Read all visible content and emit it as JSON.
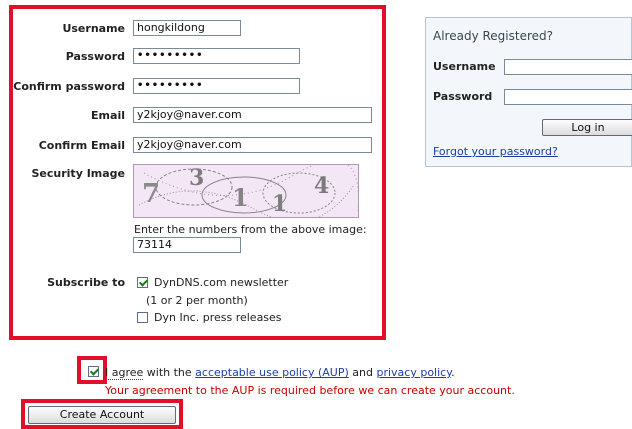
{
  "registration": {
    "username_label": "Username",
    "username_value": "hongkildong",
    "password_label": "Password",
    "password_value": "•••••••••",
    "confirm_password_label": "Confirm password",
    "confirm_password_value": "•••••••••",
    "email_label": "Email",
    "email_value": "y2kjoy@naver.com",
    "confirm_email_label": "Confirm Email",
    "confirm_email_value": "y2kjoy@naver.com",
    "security_image_label": "Security Image",
    "captcha_digits": [
      "7",
      "3",
      "1",
      "1",
      "4"
    ],
    "captcha_prompt": "Enter the numbers from the above image:",
    "captcha_value": "73114",
    "subscribe_label": "Subscribe to",
    "newsletter_label": "DynDNS.com newsletter",
    "newsletter_note": "(1 or 2 per month)",
    "newsletter_checked": true,
    "press_label": "Dyn Inc. press releases",
    "press_checked": false
  },
  "agreement": {
    "checked": true,
    "text_prefix": "I agree",
    "text_mid": " with the ",
    "aup_link": "acceptable use policy (AUP)",
    "text_and": " and ",
    "privacy_link": "privacy policy",
    "text_end": ".",
    "warning": "Your agreement to the AUP is required before we can create your account."
  },
  "create_button": "Create Account",
  "login_panel": {
    "title": "Already Registered?",
    "username_label": "Username",
    "password_label": "Password",
    "login_button": "Log in",
    "forgot_link": "Forgot your password?"
  },
  "colors": {
    "highlight_border": "#e0102a",
    "link": "#1a3ea8",
    "warning_text": "#cc0000"
  }
}
